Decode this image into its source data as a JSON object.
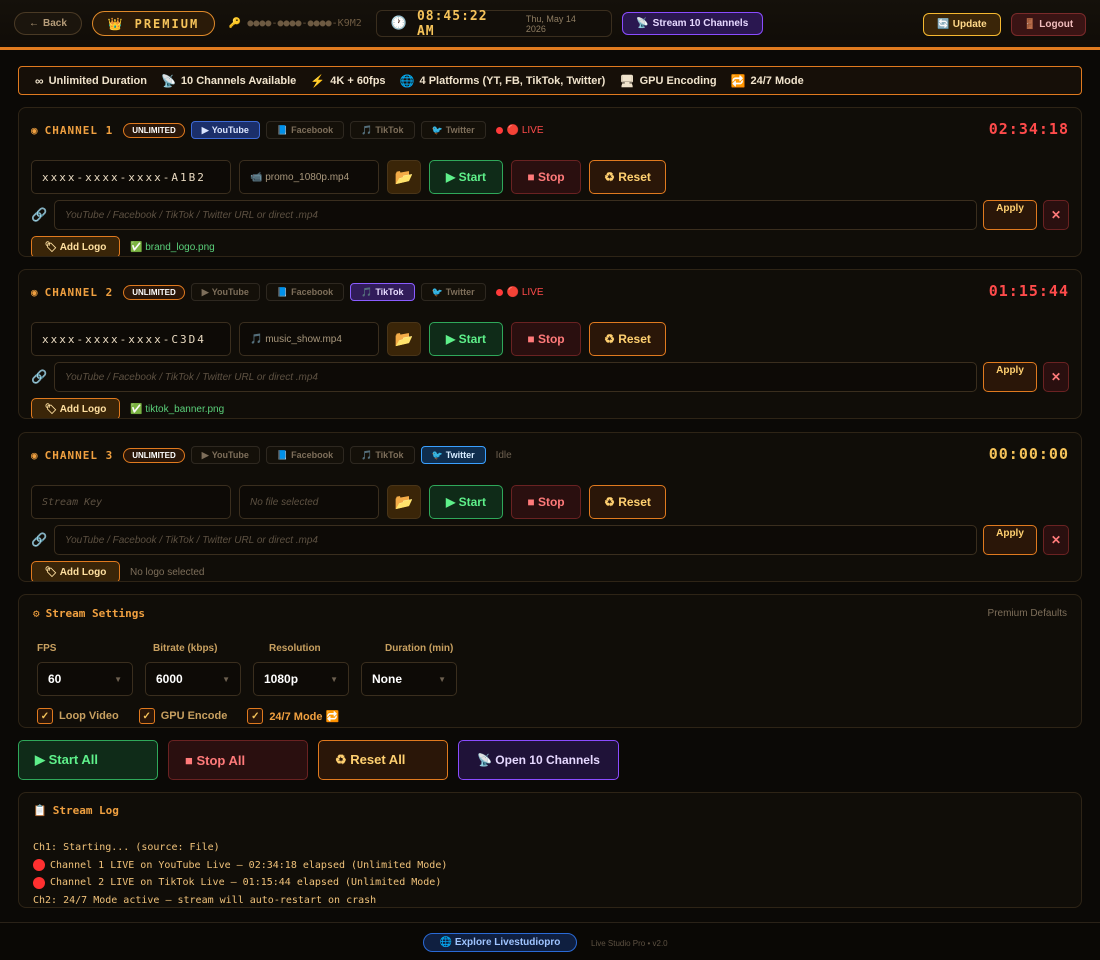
{
  "topbar": {
    "back_label": "Back",
    "premium_label": "PREMIUM",
    "key_masked": "●●●●-●●●●-●●●●-K9M2",
    "time": "08:45:22 AM",
    "date": "Thu, May 14 2026",
    "stream_label": "Stream 10 Channels",
    "update_label": "Update",
    "logout_label": "Logout"
  },
  "features": [
    {
      "icon": "∞",
      "label": "Unlimited Duration"
    },
    {
      "icon": "📡",
      "label": "10 Channels Available"
    },
    {
      "icon": "⚡",
      "label": "4K + 60fps"
    },
    {
      "icon": "🌐",
      "label": "4 Platforms (YT, FB, TikTok, Twitter)"
    },
    {
      "icon": "🖥",
      "label": "GPU Encoding"
    },
    {
      "icon": "🔁",
      "label": "24/7 Mode"
    }
  ],
  "platform_labels": {
    "youtube": "YouTube",
    "facebook": "Facebook",
    "tiktok": "TikTok",
    "twitter": "Twitter"
  },
  "channels": [
    {
      "title": "CHANNEL 1",
      "badge": "UNLIMITED",
      "status": "🔴 LIVE",
      "timer": "02:34:18",
      "stream_key": "xxxx-xxxx-xxxx-A1B2",
      "file": "📹 promo_1080p.mp4",
      "url_placeholder": "YouTube / Facebook / TikTok / Twitter URL or direct .mp4",
      "logo_status": "✅ brand_logo.png"
    },
    {
      "title": "CHANNEL 2",
      "badge": "UNLIMITED",
      "status": "🔴 LIVE",
      "timer": "01:15:44",
      "stream_key": "xxxx-xxxx-xxxx-C3D4",
      "file": "🎵 music_show.mp4",
      "url_placeholder": "YouTube / Facebook / TikTok / Twitter URL or direct .mp4",
      "logo_status": "✅ tiktok_banner.png"
    },
    {
      "title": "CHANNEL 3",
      "badge": "UNLIMITED",
      "status": "Idle",
      "timer": "00:00:00",
      "stream_key_placeholder": "Stream Key",
      "file_placeholder": "No file selected",
      "url_placeholder": "YouTube / Facebook / TikTok / Twitter URL or direct .mp4",
      "logo_status": "No logo selected"
    }
  ],
  "channel_buttons": {
    "start": "▶ Start",
    "stop": "■ Stop",
    "reset": "♻ Reset",
    "apply": "Apply",
    "clear": "✕",
    "add_logo": "🏷 Add Logo"
  },
  "settings": {
    "title": "Stream Settings",
    "subtitle": "Premium Defaults",
    "labels": [
      "FPS",
      "Bitrate (kbps)",
      "Resolution",
      "Duration (min)"
    ],
    "fps": "60",
    "bitrate": "6000",
    "resolution": "1080p",
    "duration": "None",
    "checks": {
      "loop": "Loop Video",
      "gpu": "GPU Encode",
      "mode247": "24/7 Mode 🔁"
    }
  },
  "bulk": {
    "start_all": "▶ Start All",
    "stop_all": "■ Stop All",
    "reset_all": "♻ Reset All",
    "open_channels": "📡 Open 10 Channels"
  },
  "log": {
    "title": "Stream Log",
    "lines": [
      {
        "live": false,
        "text": "Ch1: Starting... (source: File)"
      },
      {
        "live": true,
        "text": "Channel 1 LIVE on YouTube Live — 02:34:18 elapsed (Unlimited Mode)"
      },
      {
        "live": true,
        "text": "Channel 2 LIVE on TikTok Live — 01:15:44 elapsed (Unlimited Mode)"
      },
      {
        "live": false,
        "text": "Ch2: 24/7 Mode active — stream will auto-restart on crash"
      }
    ]
  },
  "footer": {
    "explore_label": "🌐 Explore Livestudiopro",
    "version": "Live Studio Pro • v2.0"
  },
  "colors": {
    "accent": "#e07a1f",
    "gold": "#f5c35a",
    "live_red": "#ff4b4b",
    "start_green": "#5ef08a",
    "purple": "#8a4cff"
  }
}
